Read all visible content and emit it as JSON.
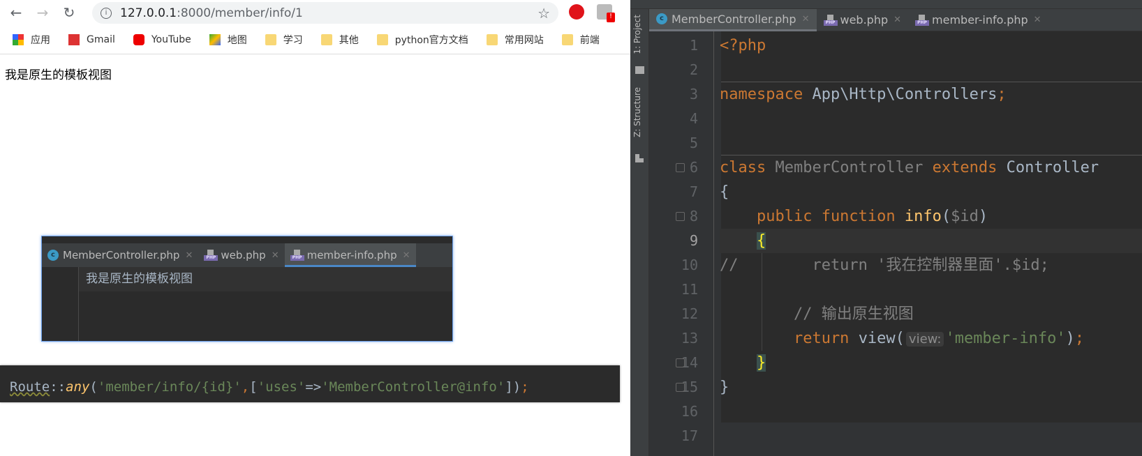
{
  "browser": {
    "url_host": "127.0.0.1",
    "url_path": ":8000/member/info/1",
    "bookmarks": [
      {
        "label": "应用",
        "icon": "apps-grid-icon"
      },
      {
        "label": "Gmail",
        "icon": "gmail-icon"
      },
      {
        "label": "YouTube",
        "icon": "youtube-icon"
      },
      {
        "label": "地图",
        "icon": "maps-icon"
      },
      {
        "label": "学习",
        "icon": "folder-icon"
      },
      {
        "label": "其他",
        "icon": "folder-icon"
      },
      {
        "label": "python官方文档",
        "icon": "folder-icon"
      },
      {
        "label": "常用网站",
        "icon": "folder-icon"
      },
      {
        "label": "前端",
        "icon": "folder-icon"
      }
    ],
    "page_text": "我是原生的模板视图"
  },
  "float_panel": {
    "tabs": [
      {
        "label": "MemberController.php",
        "icon": "php-class-icon"
      },
      {
        "label": "web.php",
        "icon": "php-file-icon"
      },
      {
        "label": "member-info.php",
        "icon": "php-file-icon",
        "active": true
      }
    ],
    "line": "我是原生的模板视图"
  },
  "route_snippet": [
    {
      "t": "Route",
      "c": "#a9b7c6",
      "wavy": true
    },
    {
      "t": "::",
      "c": "#a9b7c6"
    },
    {
      "t": "any",
      "c": "#ffc66d",
      "i": true
    },
    {
      "t": "(",
      "c": "#a9b7c6"
    },
    {
      "t": "'member/info/{id}'",
      "c": "#6a8759"
    },
    {
      "t": ",",
      "c": "#cc7832"
    },
    {
      "t": "[",
      "c": "#a9b7c6"
    },
    {
      "t": "'uses'",
      "c": "#6a8759"
    },
    {
      "t": "=>",
      "c": "#a9b7c6"
    },
    {
      "t": "'MemberController@info'",
      "c": "#6a8759"
    },
    {
      "t": "])",
      "c": "#a9b7c6"
    },
    {
      "t": ";",
      "c": "#cc7832"
    }
  ],
  "ide": {
    "side_tools": [
      "1: Project",
      "Z: Structure"
    ],
    "tabs": [
      {
        "label": "MemberController.php",
        "icon": "php-class-icon",
        "active": true
      },
      {
        "label": "web.php",
        "icon": "php-file-icon"
      },
      {
        "label": "member-info.php",
        "icon": "php-file-icon"
      }
    ],
    "current_line": 9,
    "lines": [
      {
        "n": "1",
        "tokens": [
          {
            "t": "<?php",
            "c": "#cc7832"
          }
        ]
      },
      {
        "n": "2",
        "tokens": []
      },
      {
        "n": "3",
        "tokens": [
          {
            "t": "namespace ",
            "c": "#cc7832"
          },
          {
            "t": "App\\Http\\Controllers",
            "c": "#a9b7c6"
          },
          {
            "t": ";",
            "c": "#cc7832"
          }
        ]
      },
      {
        "n": "4",
        "tokens": []
      },
      {
        "n": "5",
        "tokens": []
      },
      {
        "n": "6",
        "tokens": [
          {
            "t": "class ",
            "c": "#cc7832"
          },
          {
            "t": "MemberController ",
            "c": "#808080"
          },
          {
            "t": "extends ",
            "c": "#cc7832"
          },
          {
            "t": "Controller",
            "c": "#a9b7c6"
          }
        ]
      },
      {
        "n": "7",
        "tokens": [
          {
            "t": "{",
            "c": "#a9b7c6"
          }
        ]
      },
      {
        "n": "8",
        "tokens": [
          {
            "t": "    public function ",
            "c": "#cc7832"
          },
          {
            "t": "info",
            "c": "#ffc66d"
          },
          {
            "t": "(",
            "c": "#a9b7c6"
          },
          {
            "t": "$id",
            "c": "#808080"
          },
          {
            "t": ")",
            "c": "#a9b7c6"
          }
        ]
      },
      {
        "n": "9",
        "tokens": [
          {
            "t": "    ",
            "c": "#a9b7c6"
          },
          {
            "t": "{",
            "c": "#ffef28",
            "brace": true
          }
        ]
      },
      {
        "n": "10",
        "tokens": [
          {
            "t": "//        return '我在控制器里面'.$id;",
            "c": "#808080"
          }
        ]
      },
      {
        "n": "11",
        "tokens": []
      },
      {
        "n": "12",
        "tokens": [
          {
            "t": "        // 输出原生视图",
            "c": "#808080"
          }
        ]
      },
      {
        "n": "13",
        "tokens": [
          {
            "t": "        return ",
            "c": "#cc7832"
          },
          {
            "t": "view(",
            "c": "#a9b7c6"
          },
          {
            "t": "view:",
            "hint": true
          },
          {
            "t": "'member-info'",
            "c": "#6a8759"
          },
          {
            "t": ")",
            "c": "#a9b7c6"
          },
          {
            "t": ";",
            "c": "#cc7832"
          }
        ]
      },
      {
        "n": "14",
        "tokens": [
          {
            "t": "    ",
            "c": "#a9b7c6"
          },
          {
            "t": "}",
            "c": "#ffef28",
            "brace": true
          }
        ]
      },
      {
        "n": "15",
        "tokens": [
          {
            "t": "}",
            "c": "#a9b7c6"
          }
        ]
      },
      {
        "n": "16",
        "tokens": []
      },
      {
        "n": "17",
        "tokens": []
      }
    ]
  }
}
